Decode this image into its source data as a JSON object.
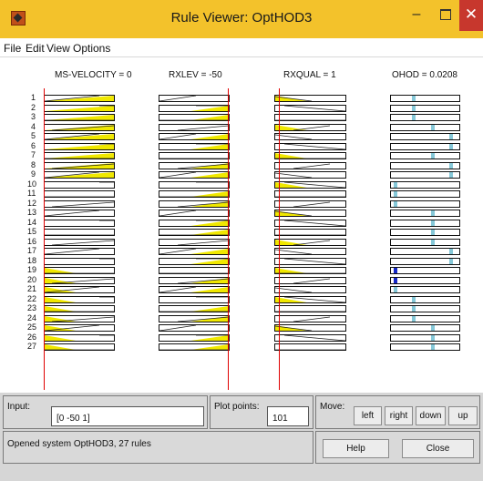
{
  "window": {
    "title": "Rule Viewer: OptHOD3",
    "min_glyph": "–",
    "close_glyph": "✕"
  },
  "menu": [
    "File",
    "Edit",
    "View",
    "Options"
  ],
  "columns": [
    {
      "header": "MS-VELOCITY = 0"
    },
    {
      "header": "RXLEV = -50"
    },
    {
      "header": "RXQUAL = 1"
    },
    {
      "header": "OHOD = 0.0208"
    }
  ],
  "rule_numbers": [
    "1",
    "2",
    "3",
    "4",
    "5",
    "6",
    "7",
    "8",
    "9",
    "10",
    "11",
    "12",
    "13",
    "14",
    "15",
    "16",
    "17",
    "18",
    "19",
    "20",
    "21",
    "22",
    "23",
    "24",
    "25",
    "26",
    "27"
  ],
  "input": {
    "label": "Input:",
    "value": "[0 -50 1]"
  },
  "plot_points": {
    "label": "Plot points:",
    "value": "101"
  },
  "move": {
    "label": "Move:",
    "left": "left",
    "right": "right",
    "down": "down",
    "up": "up"
  },
  "status": "Opened system OptHOD3, 27 rules",
  "help_label": "Help",
  "close_label": "Close",
  "colors": {
    "accent_title": "#f3c22b",
    "fill": "#f0e800",
    "input_line": "#e00000",
    "output_marker": "#86c8d8",
    "fired_marker": "#1428c8"
  }
}
